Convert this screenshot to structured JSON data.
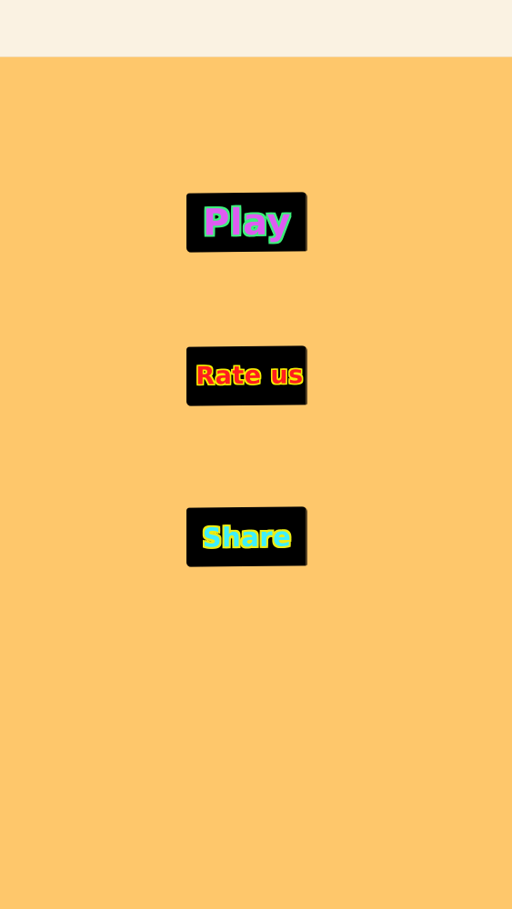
{
  "menu": {
    "play_label": "Play",
    "rate_label": "Rate us",
    "share_label": "Share"
  },
  "colors": {
    "top_bar": "#faf2e2",
    "background": "#fec76b",
    "button_bg": "#000000",
    "play_fill": "#de5cf1",
    "play_outline": "#3cf07a",
    "rate_fill": "#ff1e1e",
    "rate_outline": "#f4f000",
    "share_fill": "#3ff0ff",
    "share_outline": "#ecec14"
  }
}
